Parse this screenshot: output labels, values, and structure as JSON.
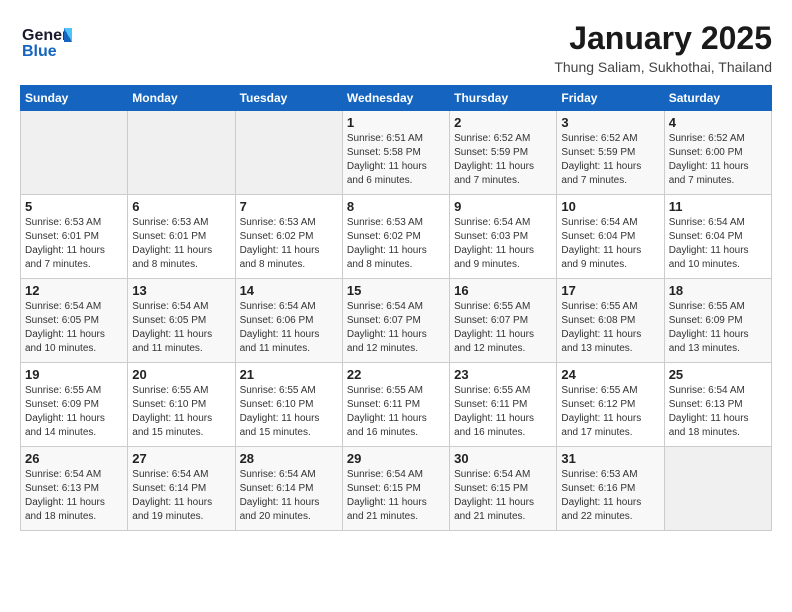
{
  "header": {
    "logo_line1": "General",
    "logo_line2": "Blue",
    "main_title": "January 2025",
    "sub_title": "Thung Saliam, Sukhothai, Thailand"
  },
  "columns": [
    "Sunday",
    "Monday",
    "Tuesday",
    "Wednesday",
    "Thursday",
    "Friday",
    "Saturday"
  ],
  "weeks": [
    [
      {
        "day": "",
        "info": ""
      },
      {
        "day": "",
        "info": ""
      },
      {
        "day": "",
        "info": ""
      },
      {
        "day": "1",
        "info": "Sunrise: 6:51 AM\nSunset: 5:58 PM\nDaylight: 11 hours and 6 minutes."
      },
      {
        "day": "2",
        "info": "Sunrise: 6:52 AM\nSunset: 5:59 PM\nDaylight: 11 hours and 7 minutes."
      },
      {
        "day": "3",
        "info": "Sunrise: 6:52 AM\nSunset: 5:59 PM\nDaylight: 11 hours and 7 minutes."
      },
      {
        "day": "4",
        "info": "Sunrise: 6:52 AM\nSunset: 6:00 PM\nDaylight: 11 hours and 7 minutes."
      }
    ],
    [
      {
        "day": "5",
        "info": "Sunrise: 6:53 AM\nSunset: 6:01 PM\nDaylight: 11 hours and 7 minutes."
      },
      {
        "day": "6",
        "info": "Sunrise: 6:53 AM\nSunset: 6:01 PM\nDaylight: 11 hours and 8 minutes."
      },
      {
        "day": "7",
        "info": "Sunrise: 6:53 AM\nSunset: 6:02 PM\nDaylight: 11 hours and 8 minutes."
      },
      {
        "day": "8",
        "info": "Sunrise: 6:53 AM\nSunset: 6:02 PM\nDaylight: 11 hours and 8 minutes."
      },
      {
        "day": "9",
        "info": "Sunrise: 6:54 AM\nSunset: 6:03 PM\nDaylight: 11 hours and 9 minutes."
      },
      {
        "day": "10",
        "info": "Sunrise: 6:54 AM\nSunset: 6:04 PM\nDaylight: 11 hours and 9 minutes."
      },
      {
        "day": "11",
        "info": "Sunrise: 6:54 AM\nSunset: 6:04 PM\nDaylight: 11 hours and 10 minutes."
      }
    ],
    [
      {
        "day": "12",
        "info": "Sunrise: 6:54 AM\nSunset: 6:05 PM\nDaylight: 11 hours and 10 minutes."
      },
      {
        "day": "13",
        "info": "Sunrise: 6:54 AM\nSunset: 6:05 PM\nDaylight: 11 hours and 11 minutes."
      },
      {
        "day": "14",
        "info": "Sunrise: 6:54 AM\nSunset: 6:06 PM\nDaylight: 11 hours and 11 minutes."
      },
      {
        "day": "15",
        "info": "Sunrise: 6:54 AM\nSunset: 6:07 PM\nDaylight: 11 hours and 12 minutes."
      },
      {
        "day": "16",
        "info": "Sunrise: 6:55 AM\nSunset: 6:07 PM\nDaylight: 11 hours and 12 minutes."
      },
      {
        "day": "17",
        "info": "Sunrise: 6:55 AM\nSunset: 6:08 PM\nDaylight: 11 hours and 13 minutes."
      },
      {
        "day": "18",
        "info": "Sunrise: 6:55 AM\nSunset: 6:09 PM\nDaylight: 11 hours and 13 minutes."
      }
    ],
    [
      {
        "day": "19",
        "info": "Sunrise: 6:55 AM\nSunset: 6:09 PM\nDaylight: 11 hours and 14 minutes."
      },
      {
        "day": "20",
        "info": "Sunrise: 6:55 AM\nSunset: 6:10 PM\nDaylight: 11 hours and 15 minutes."
      },
      {
        "day": "21",
        "info": "Sunrise: 6:55 AM\nSunset: 6:10 PM\nDaylight: 11 hours and 15 minutes."
      },
      {
        "day": "22",
        "info": "Sunrise: 6:55 AM\nSunset: 6:11 PM\nDaylight: 11 hours and 16 minutes."
      },
      {
        "day": "23",
        "info": "Sunrise: 6:55 AM\nSunset: 6:11 PM\nDaylight: 11 hours and 16 minutes."
      },
      {
        "day": "24",
        "info": "Sunrise: 6:55 AM\nSunset: 6:12 PM\nDaylight: 11 hours and 17 minutes."
      },
      {
        "day": "25",
        "info": "Sunrise: 6:54 AM\nSunset: 6:13 PM\nDaylight: 11 hours and 18 minutes."
      }
    ],
    [
      {
        "day": "26",
        "info": "Sunrise: 6:54 AM\nSunset: 6:13 PM\nDaylight: 11 hours and 18 minutes."
      },
      {
        "day": "27",
        "info": "Sunrise: 6:54 AM\nSunset: 6:14 PM\nDaylight: 11 hours and 19 minutes."
      },
      {
        "day": "28",
        "info": "Sunrise: 6:54 AM\nSunset: 6:14 PM\nDaylight: 11 hours and 20 minutes."
      },
      {
        "day": "29",
        "info": "Sunrise: 6:54 AM\nSunset: 6:15 PM\nDaylight: 11 hours and 21 minutes."
      },
      {
        "day": "30",
        "info": "Sunrise: 6:54 AM\nSunset: 6:15 PM\nDaylight: 11 hours and 21 minutes."
      },
      {
        "day": "31",
        "info": "Sunrise: 6:53 AM\nSunset: 6:16 PM\nDaylight: 11 hours and 22 minutes."
      },
      {
        "day": "",
        "info": ""
      }
    ]
  ]
}
